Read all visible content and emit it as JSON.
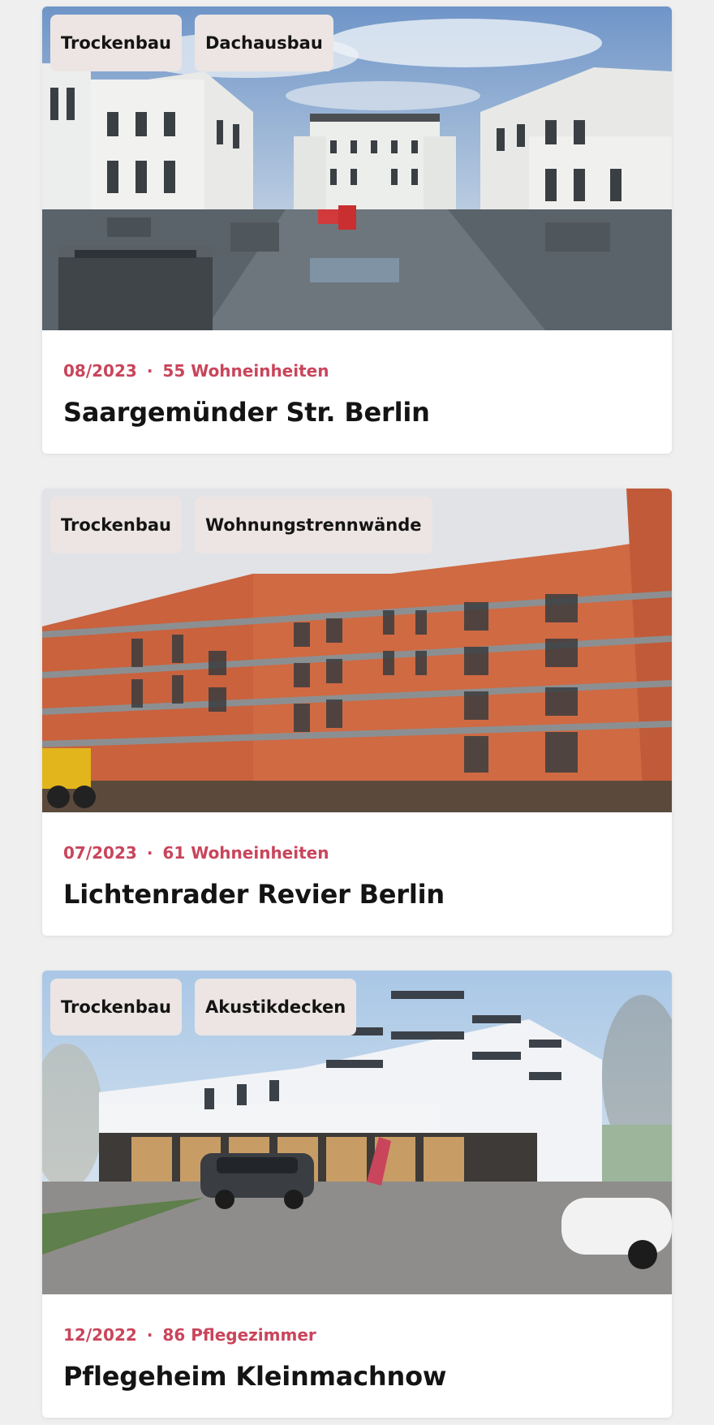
{
  "projects": [
    {
      "tags": [
        "Trockenbau",
        "Dachausbau"
      ],
      "date": "08/2023",
      "units": "55 Wohneinheiten",
      "title": "Saargemünder Str. Berlin",
      "image": "construction-site-photo"
    },
    {
      "tags": [
        "Trockenbau",
        "Wohnungstrennwände"
      ],
      "date": "07/2023",
      "units": "61 Wohneinheiten",
      "title": "Lichtenrader Revier Berlin",
      "image": "apartment-building-photo"
    },
    {
      "tags": [
        "Trockenbau",
        "Akustikdecken"
      ],
      "date": "12/2022",
      "units": "86 Pflegezimmer",
      "title": "Pflegeheim Kleinmachnow",
      "image": "care-home-photo"
    }
  ],
  "meta_separator": "·",
  "colors": {
    "background": "#efefef",
    "accent": "#c9455b",
    "tag_background": "#ece5e3",
    "text": "#141414"
  }
}
